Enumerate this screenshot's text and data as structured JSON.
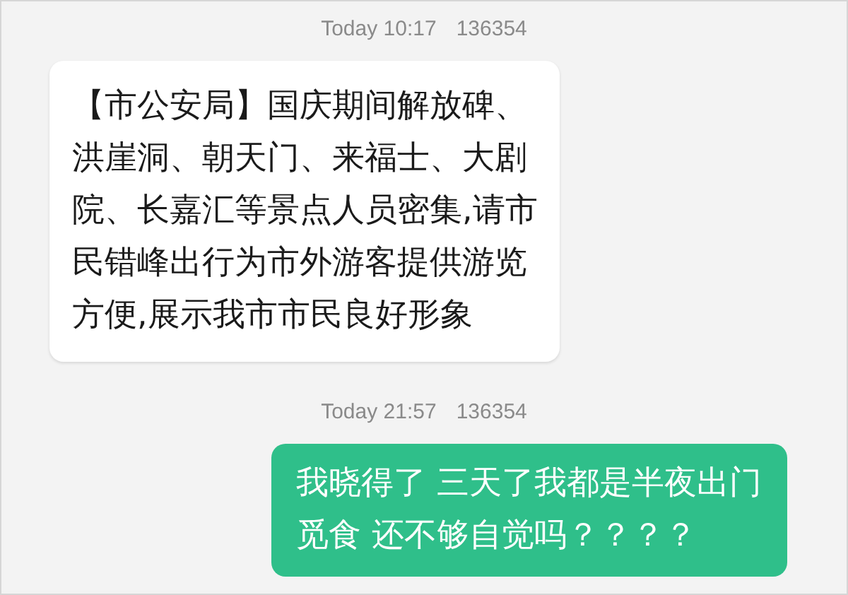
{
  "messages": [
    {
      "time": "Today 10:17",
      "sender": "136354",
      "kind": "received",
      "lines": [
        "【市公安局】国庆期间解放碑、",
        "洪崖洞、朝天门、来福士、大剧",
        "院、长嘉汇等景点人员密集,请市",
        "民错峰出行为市外游客提供游览",
        "方便,展示我市市民良好形象"
      ]
    },
    {
      "time": "Today 21:57",
      "sender": "136354",
      "kind": "sent",
      "lines": [
        "我晓得了 三天了我都是半夜出门",
        "觅食 还不够自觉吗？？？？"
      ]
    }
  ]
}
